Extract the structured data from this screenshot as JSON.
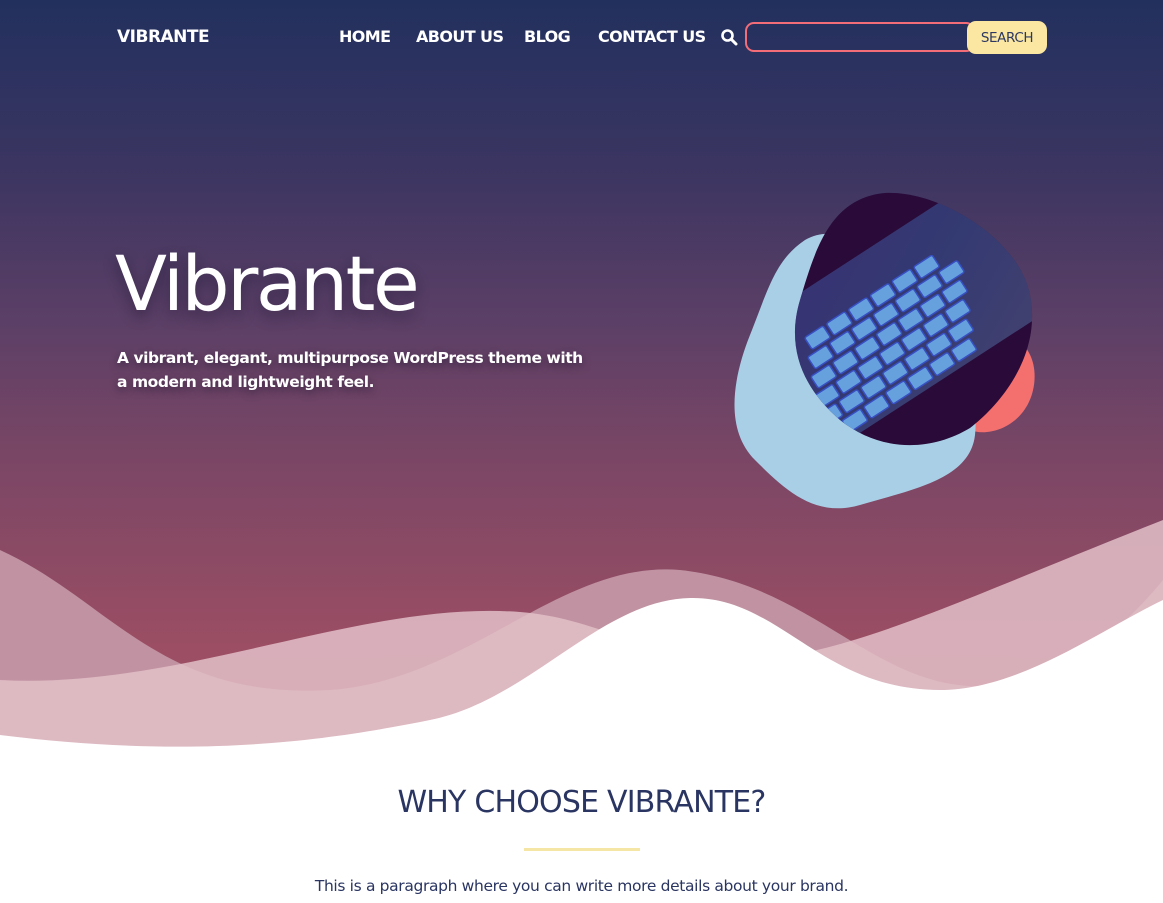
{
  "header": {
    "logo": "VIBRANTE",
    "nav": [
      "HOME",
      "ABOUT US",
      "BLOG",
      "CONTACT US"
    ],
    "search_placeholder": "",
    "search_button": "SEARCH"
  },
  "hero": {
    "title": "Vibrante",
    "tagline": "A vibrant, elegant, multipurpose WordPress theme with a modern and lightweight feel."
  },
  "section": {
    "title": "WHY CHOOSE VIBRANTE?",
    "text": "This is a paragraph where you can write more details about your brand."
  },
  "colors": {
    "navy": "#22305e",
    "hero_bottom": "#a35466",
    "coral": "#f26d78",
    "cream": "#fbe7a1",
    "light_blue": "#a9cfe7"
  }
}
